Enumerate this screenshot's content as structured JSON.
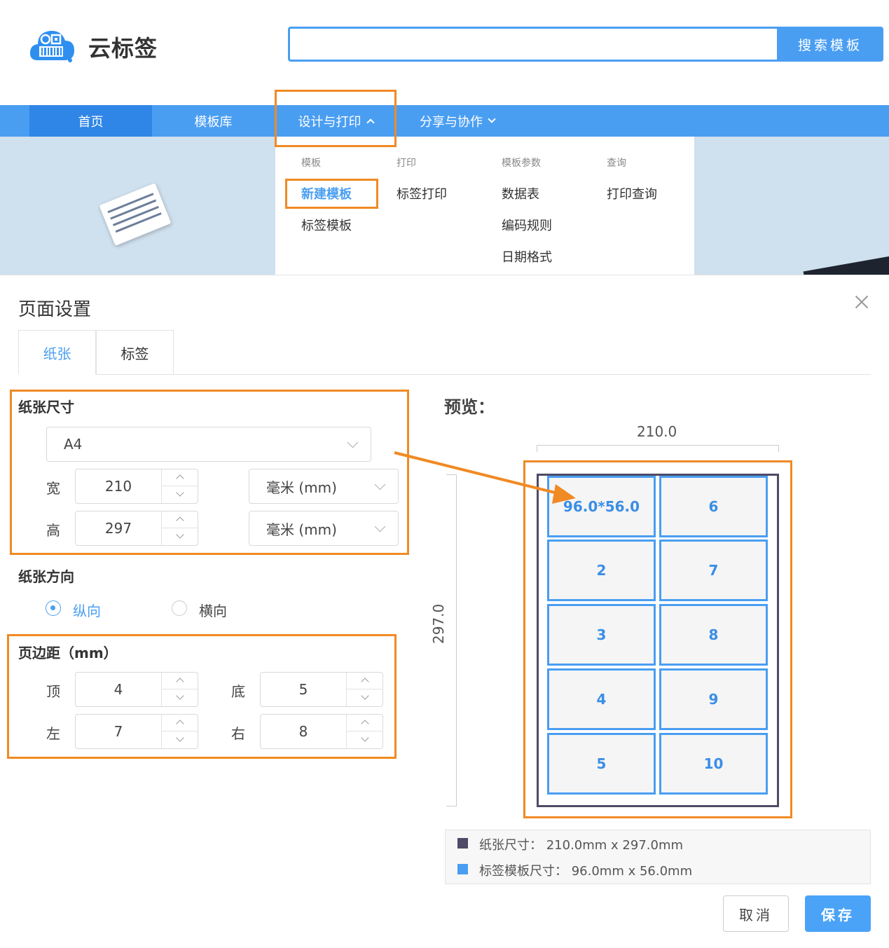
{
  "header": {
    "logo_text": "云标签",
    "search_placeholder": "",
    "search_button": "搜索模板"
  },
  "nav": {
    "items": [
      {
        "label": "首页"
      },
      {
        "label": "模板库"
      },
      {
        "label": "设计与打印"
      },
      {
        "label": "分享与协作"
      }
    ]
  },
  "dropdown": {
    "columns": [
      {
        "heading": "模板",
        "items": [
          "新建模板",
          "标签模板"
        ]
      },
      {
        "heading": "打印",
        "items": [
          "标签打印"
        ]
      },
      {
        "heading": "模板参数",
        "items": [
          "数据表",
          "编码规则",
          "日期格式"
        ]
      },
      {
        "heading": "查询",
        "items": [
          "打印查询"
        ]
      }
    ],
    "active_item": "新建模板"
  },
  "dialog": {
    "title": "页面设置",
    "tabs": [
      "纸张",
      "标签"
    ],
    "active_tab": "纸张",
    "paper_size": {
      "section_title": "纸张尺寸",
      "preset": "A4",
      "width_label": "宽",
      "width": "210",
      "width_unit": "毫米 (mm)",
      "height_label": "高",
      "height": "297",
      "height_unit": "毫米 (mm)"
    },
    "orientation": {
      "section_title": "纸张方向",
      "portrait": "纵向",
      "landscape": "横向",
      "selected": "portrait"
    },
    "margins": {
      "section_title": "页边距（mm）",
      "top_label": "顶",
      "top": "4",
      "bottom_label": "底",
      "bottom": "5",
      "left_label": "左",
      "left": "7",
      "right_label": "右",
      "right": "8"
    },
    "preview": {
      "title": "预览：",
      "width_dim": "210.0",
      "height_dim": "297.0",
      "cells": [
        "96.0*56.0",
        "6",
        "2",
        "7",
        "3",
        "8",
        "4",
        "9",
        "5",
        "10"
      ],
      "legend": [
        {
          "text": "纸张尺寸：  210.0mm x 297.0mm",
          "color": "#4e4b66"
        },
        {
          "text": "标签模板尺寸：  96.0mm x 56.0mm",
          "color": "#4a9ef2"
        }
      ]
    },
    "buttons": {
      "cancel": "取消",
      "save": "保存"
    }
  },
  "colors": {
    "accent": "#4a9ef2",
    "highlight": "#f08a24",
    "paper_border": "#4e4b66"
  }
}
